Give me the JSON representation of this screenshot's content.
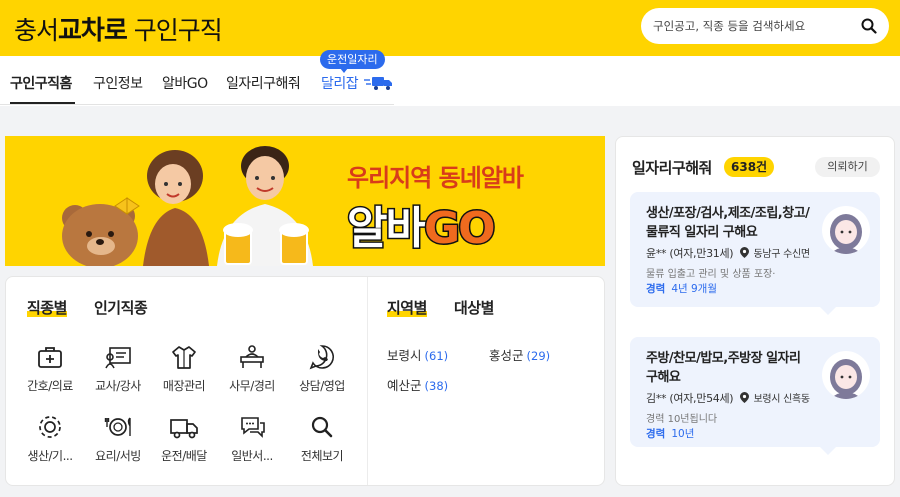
{
  "header": {
    "logo_region": "충서",
    "logo_brand": "교차로",
    "logo_service": "구인구직",
    "search_placeholder": "구인공고, 직종 등을 검색하세요"
  },
  "nav": {
    "tabs": [
      {
        "label": "구인구직홈"
      },
      {
        "label": "구인정보"
      },
      {
        "label": "알바GO"
      },
      {
        "label": "일자리구해줘"
      },
      {
        "label": "달리잡"
      }
    ],
    "badge": "운전일자리"
  },
  "banner": {
    "subtitle": "우리지역 동네알바",
    "title_a": "알바",
    "title_b": "GO"
  },
  "categories": {
    "tabs": [
      "직종별",
      "인기직종"
    ],
    "items": [
      {
        "label": "간호/의료",
        "icon": "medical-kit-icon"
      },
      {
        "label": "교사/강사",
        "icon": "teacher-board-icon"
      },
      {
        "label": "매장관리",
        "icon": "shirt-icon"
      },
      {
        "label": "사무/경리",
        "icon": "office-desk-icon"
      },
      {
        "label": "상담/영업",
        "icon": "phone-chat-icon"
      },
      {
        "label": "생산/기...",
        "icon": "gear-icon"
      },
      {
        "label": "요리/서빙",
        "icon": "plate-icon"
      },
      {
        "label": "운전/배달",
        "icon": "truck-icon"
      },
      {
        "label": "일반서...",
        "icon": "speech-bubble-icon"
      },
      {
        "label": "전체보기",
        "icon": "search-icon"
      }
    ]
  },
  "regions": {
    "tabs": [
      "지역별",
      "대상별"
    ],
    "items": [
      {
        "name": "보령시",
        "count": "(61)"
      },
      {
        "name": "홍성군",
        "count": "(29)"
      },
      {
        "name": "예산군",
        "count": "(38)"
      }
    ]
  },
  "side": {
    "title": "일자리구해줘",
    "count": "638건",
    "request_label": "의뢰하기",
    "jobs": [
      {
        "title": "생산/포장/검사,제조/조립,창고/물류직 일자리 구해요",
        "person": "윤** (여자,만31세)",
        "location": "동남구 수신면",
        "desc": "물류 입출고 관리 및 상품 포장·",
        "exp_label": "경력",
        "exp_value": "4년 9개월"
      },
      {
        "title": "주방/찬모/밥모,주방장 일자리 구해요",
        "person": "김** (여자,만54세)",
        "location": "보령시 신흑동",
        "desc": "경력 10년됩니다",
        "exp_label": "경력",
        "exp_value": "10년"
      }
    ]
  },
  "colors": {
    "brand_yellow": "#ffd400",
    "accent_blue": "#2c6bed",
    "banner_red": "#d83c1a",
    "banner_orange": "#f06a1e"
  }
}
